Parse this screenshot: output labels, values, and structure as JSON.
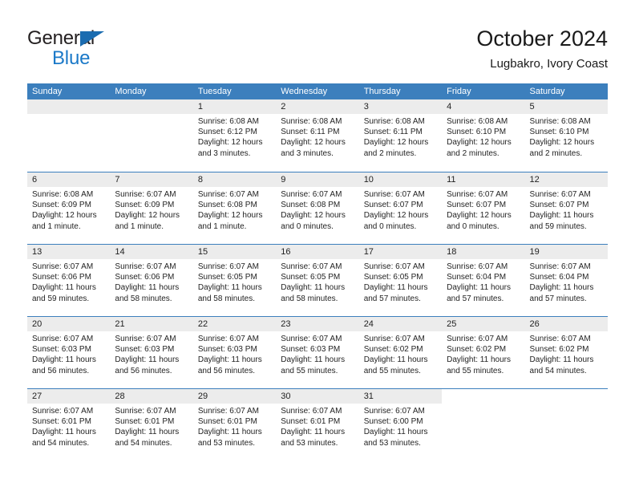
{
  "brand": {
    "line1": "General",
    "line2": "Blue",
    "triangle_color": "#1b6cb0",
    "line2_color": "#1b79c8"
  },
  "header": {
    "title": "October 2024",
    "subtitle": "Lugbakro, Ivory Coast"
  },
  "colors": {
    "header_row_bg": "#3c7fbd",
    "header_row_text": "#ffffff",
    "daynum_bg": "#ececec",
    "cell_bg": "#ffffff",
    "text": "#232323"
  },
  "weekdays": [
    "Sunday",
    "Monday",
    "Tuesday",
    "Wednesday",
    "Thursday",
    "Friday",
    "Saturday"
  ],
  "weeks": [
    [
      {
        "day": "",
        "lines": [],
        "state": "blank"
      },
      {
        "day": "",
        "lines": [],
        "state": "blank"
      },
      {
        "day": "1",
        "lines": [
          "Sunrise: 6:08 AM",
          "Sunset: 6:12 PM",
          "Daylight: 12 hours",
          "and 3 minutes."
        ],
        "state": "filled"
      },
      {
        "day": "2",
        "lines": [
          "Sunrise: 6:08 AM",
          "Sunset: 6:11 PM",
          "Daylight: 12 hours",
          "and 3 minutes."
        ],
        "state": "filled"
      },
      {
        "day": "3",
        "lines": [
          "Sunrise: 6:08 AM",
          "Sunset: 6:11 PM",
          "Daylight: 12 hours",
          "and 2 minutes."
        ],
        "state": "filled"
      },
      {
        "day": "4",
        "lines": [
          "Sunrise: 6:08 AM",
          "Sunset: 6:10 PM",
          "Daylight: 12 hours",
          "and 2 minutes."
        ],
        "state": "filled"
      },
      {
        "day": "5",
        "lines": [
          "Sunrise: 6:08 AM",
          "Sunset: 6:10 PM",
          "Daylight: 12 hours",
          "and 2 minutes."
        ],
        "state": "filled"
      }
    ],
    [
      {
        "day": "6",
        "lines": [
          "Sunrise: 6:08 AM",
          "Sunset: 6:09 PM",
          "Daylight: 12 hours",
          "and 1 minute."
        ],
        "state": "filled"
      },
      {
        "day": "7",
        "lines": [
          "Sunrise: 6:07 AM",
          "Sunset: 6:09 PM",
          "Daylight: 12 hours",
          "and 1 minute."
        ],
        "state": "filled"
      },
      {
        "day": "8",
        "lines": [
          "Sunrise: 6:07 AM",
          "Sunset: 6:08 PM",
          "Daylight: 12 hours",
          "and 1 minute."
        ],
        "state": "filled"
      },
      {
        "day": "9",
        "lines": [
          "Sunrise: 6:07 AM",
          "Sunset: 6:08 PM",
          "Daylight: 12 hours",
          "and 0 minutes."
        ],
        "state": "filled"
      },
      {
        "day": "10",
        "lines": [
          "Sunrise: 6:07 AM",
          "Sunset: 6:07 PM",
          "Daylight: 12 hours",
          "and 0 minutes."
        ],
        "state": "filled"
      },
      {
        "day": "11",
        "lines": [
          "Sunrise: 6:07 AM",
          "Sunset: 6:07 PM",
          "Daylight: 12 hours",
          "and 0 minutes."
        ],
        "state": "filled"
      },
      {
        "day": "12",
        "lines": [
          "Sunrise: 6:07 AM",
          "Sunset: 6:07 PM",
          "Daylight: 11 hours",
          "and 59 minutes."
        ],
        "state": "filled"
      }
    ],
    [
      {
        "day": "13",
        "lines": [
          "Sunrise: 6:07 AM",
          "Sunset: 6:06 PM",
          "Daylight: 11 hours",
          "and 59 minutes."
        ],
        "state": "filled"
      },
      {
        "day": "14",
        "lines": [
          "Sunrise: 6:07 AM",
          "Sunset: 6:06 PM",
          "Daylight: 11 hours",
          "and 58 minutes."
        ],
        "state": "filled"
      },
      {
        "day": "15",
        "lines": [
          "Sunrise: 6:07 AM",
          "Sunset: 6:05 PM",
          "Daylight: 11 hours",
          "and 58 minutes."
        ],
        "state": "filled"
      },
      {
        "day": "16",
        "lines": [
          "Sunrise: 6:07 AM",
          "Sunset: 6:05 PM",
          "Daylight: 11 hours",
          "and 58 minutes."
        ],
        "state": "filled"
      },
      {
        "day": "17",
        "lines": [
          "Sunrise: 6:07 AM",
          "Sunset: 6:05 PM",
          "Daylight: 11 hours",
          "and 57 minutes."
        ],
        "state": "filled"
      },
      {
        "day": "18",
        "lines": [
          "Sunrise: 6:07 AM",
          "Sunset: 6:04 PM",
          "Daylight: 11 hours",
          "and 57 minutes."
        ],
        "state": "filled"
      },
      {
        "day": "19",
        "lines": [
          "Sunrise: 6:07 AM",
          "Sunset: 6:04 PM",
          "Daylight: 11 hours",
          "and 57 minutes."
        ],
        "state": "filled"
      }
    ],
    [
      {
        "day": "20",
        "lines": [
          "Sunrise: 6:07 AM",
          "Sunset: 6:03 PM",
          "Daylight: 11 hours",
          "and 56 minutes."
        ],
        "state": "filled"
      },
      {
        "day": "21",
        "lines": [
          "Sunrise: 6:07 AM",
          "Sunset: 6:03 PM",
          "Daylight: 11 hours",
          "and 56 minutes."
        ],
        "state": "filled"
      },
      {
        "day": "22",
        "lines": [
          "Sunrise: 6:07 AM",
          "Sunset: 6:03 PM",
          "Daylight: 11 hours",
          "and 56 minutes."
        ],
        "state": "filled"
      },
      {
        "day": "23",
        "lines": [
          "Sunrise: 6:07 AM",
          "Sunset: 6:03 PM",
          "Daylight: 11 hours",
          "and 55 minutes."
        ],
        "state": "filled"
      },
      {
        "day": "24",
        "lines": [
          "Sunrise: 6:07 AM",
          "Sunset: 6:02 PM",
          "Daylight: 11 hours",
          "and 55 minutes."
        ],
        "state": "filled"
      },
      {
        "day": "25",
        "lines": [
          "Sunrise: 6:07 AM",
          "Sunset: 6:02 PM",
          "Daylight: 11 hours",
          "and 55 minutes."
        ],
        "state": "filled"
      },
      {
        "day": "26",
        "lines": [
          "Sunrise: 6:07 AM",
          "Sunset: 6:02 PM",
          "Daylight: 11 hours",
          "and 54 minutes."
        ],
        "state": "filled"
      }
    ],
    [
      {
        "day": "27",
        "lines": [
          "Sunrise: 6:07 AM",
          "Sunset: 6:01 PM",
          "Daylight: 11 hours",
          "and 54 minutes."
        ],
        "state": "filled"
      },
      {
        "day": "28",
        "lines": [
          "Sunrise: 6:07 AM",
          "Sunset: 6:01 PM",
          "Daylight: 11 hours",
          "and 54 minutes."
        ],
        "state": "filled"
      },
      {
        "day": "29",
        "lines": [
          "Sunrise: 6:07 AM",
          "Sunset: 6:01 PM",
          "Daylight: 11 hours",
          "and 53 minutes."
        ],
        "state": "filled"
      },
      {
        "day": "30",
        "lines": [
          "Sunrise: 6:07 AM",
          "Sunset: 6:01 PM",
          "Daylight: 11 hours",
          "and 53 minutes."
        ],
        "state": "filled"
      },
      {
        "day": "31",
        "lines": [
          "Sunrise: 6:07 AM",
          "Sunset: 6:00 PM",
          "Daylight: 11 hours",
          "and 53 minutes."
        ],
        "state": "filled"
      },
      {
        "day": "",
        "lines": [],
        "state": "empty"
      },
      {
        "day": "",
        "lines": [],
        "state": "empty"
      }
    ]
  ]
}
